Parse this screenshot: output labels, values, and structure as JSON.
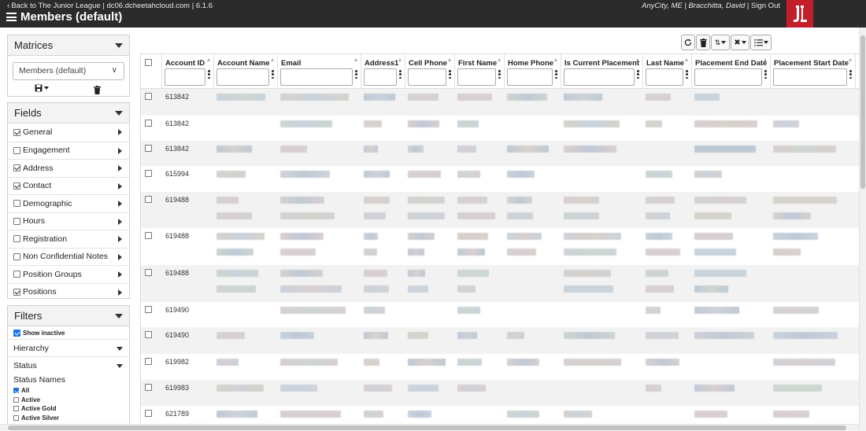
{
  "topbar": {
    "back_link": "Back to The Junior League",
    "host": "dc06.dcheetahcloud.com",
    "version": "6.1.6",
    "page_title": "Members (default)",
    "location": "AnyCity, ME",
    "user": "Bracchitta, David",
    "sign_out": "Sign Out",
    "separator": "|",
    "logo_text": "JL"
  },
  "matrices": {
    "title": "Matrices",
    "selected": "Members (default)"
  },
  "fields": {
    "title": "Fields",
    "items": [
      {
        "label": "General",
        "checked": true
      },
      {
        "label": "Engagement",
        "checked": false
      },
      {
        "label": "Address",
        "checked": true
      },
      {
        "label": "Contact",
        "checked": true
      },
      {
        "label": "Demographic",
        "checked": false
      },
      {
        "label": "Hours",
        "checked": false
      },
      {
        "label": "Registration",
        "checked": false
      },
      {
        "label": "Non Confidential Notes",
        "checked": false
      },
      {
        "label": "Position Groups",
        "checked": false
      },
      {
        "label": "Positions",
        "checked": true
      }
    ]
  },
  "filters": {
    "title": "Filters",
    "show_inactive": "Show inactive",
    "hierarchy": "Hierarchy",
    "status": "Status",
    "status_names_label": "Status Names",
    "status_options": [
      {
        "label": "All",
        "checked": true
      },
      {
        "label": "Active",
        "checked": false
      },
      {
        "label": "Active Gold",
        "checked": false
      },
      {
        "label": "Active Silver",
        "checked": false
      }
    ]
  },
  "grid": {
    "columns": [
      "Account ID",
      "Account Name",
      "Email",
      "Address1",
      "Cell Phone",
      "First Name",
      "Home Phone",
      "Is Current Placement",
      "Last Name",
      "Placement End Date",
      "Placement Start Date"
    ],
    "rows": [
      {
        "account_id": "613842"
      },
      {
        "account_id": "613842"
      },
      {
        "account_id": "613842"
      },
      {
        "account_id": "615994"
      },
      {
        "account_id": "619488"
      },
      {
        "account_id": "619488"
      },
      {
        "account_id": "619488"
      },
      {
        "account_id": "619490"
      },
      {
        "account_id": "619490"
      },
      {
        "account_id": "619982"
      },
      {
        "account_id": "619983"
      },
      {
        "account_id": "621789"
      }
    ]
  },
  "colors": {
    "topbar_bg": "#2b2b2b",
    "logo_bg": "#c41e2b",
    "row_alt": "#f2f2f2",
    "check_blue": "#1a73e8"
  }
}
